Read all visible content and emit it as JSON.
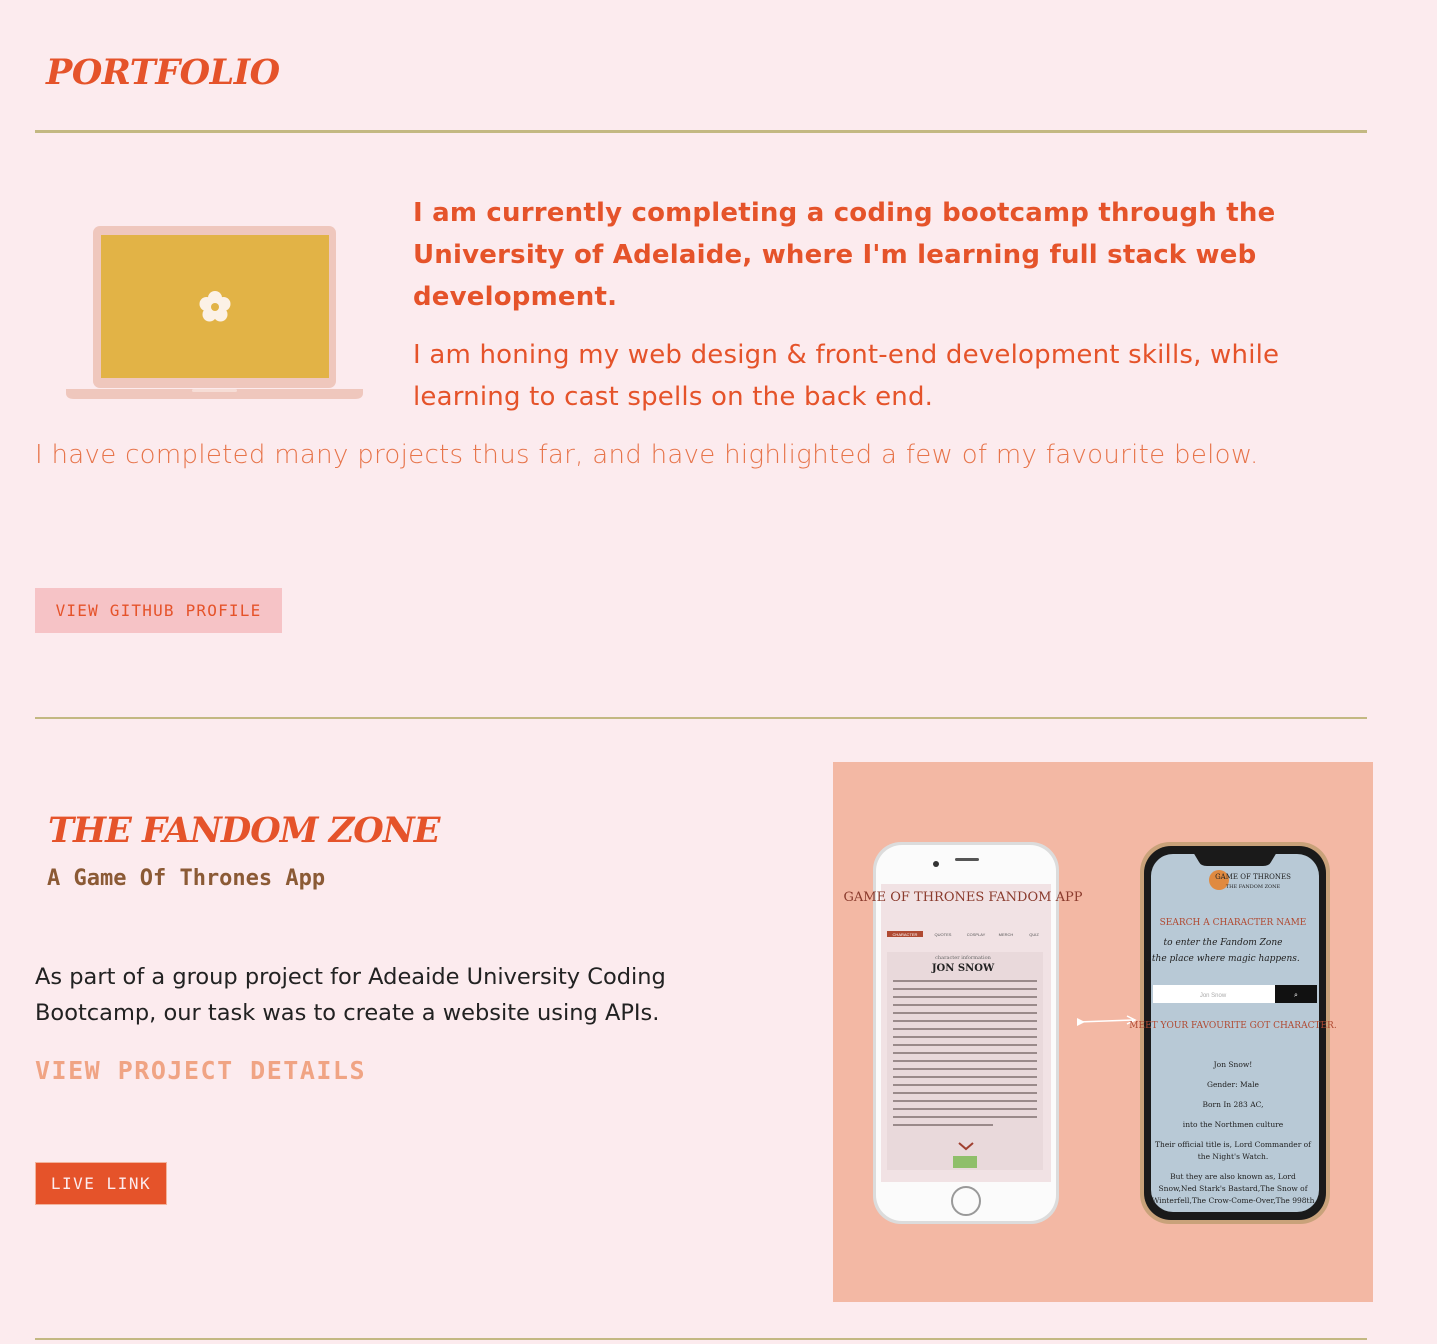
{
  "header": {
    "title": "PORTFOLIO"
  },
  "intro": {
    "lead": "I am currently completing a coding bootcamp through the University of Adelaide, where I'm learning full stack web development.",
    "second": "I am honing my web design & front-end development skills, while learning to cast spells on the back end.",
    "third": "I have completed many projects thus far, and have highlighted a few of my favourite below.",
    "github_button": "VIEW GITHUB PROFILE"
  },
  "project": {
    "title": "THE FANDOM ZONE",
    "subtitle": "A Game Of Thrones App",
    "description": "As part of a group project for Adeaide University Coding Bootcamp, our task was to create a website using APIs.",
    "details_link": "VIEW PROJECT DETAILS",
    "live_button": "LIVE LINK",
    "mockup": {
      "left_title": "GAME OF THRONES FANDOM APP",
      "left_tabs": [
        "CHARACTER",
        "QUOTES",
        "COSPLAY",
        "MERCH",
        "QUIZ"
      ],
      "left_caption": "character information",
      "left_name": "JON SNOW",
      "right_logo": "GAME OF THRONES",
      "right_logo_sub": "THE FANDOM ZONE",
      "right_heading": "SEARCH A CHARACTER NAME",
      "right_tagline_1": "to enter the Fandom Zone",
      "right_tagline_2": "..the place where magic happens.",
      "right_input": "Jon Snow",
      "right_meet": "MEET YOUR FAVOURITE GOT CHARACTER.",
      "right_lines": [
        "Jon Snow!",
        "Gender: Male",
        "Born In 283 AC,",
        "into the Northmen culture",
        "Their official title is, Lord Commander of",
        "the Night's Watch.",
        "But they are also known as, Lord",
        "Snow,Ned Stark's Bastard,The Snow of",
        "Winterfell,The Crow-Come-Over,The 998th"
      ]
    }
  },
  "colors": {
    "background": "#fcebee",
    "accent": "#e5532a",
    "rule": "#c3b882",
    "button_soft": "#f6c3c6",
    "image_bg": "#f3b8a4",
    "laptop_screen": "#e2b346"
  }
}
